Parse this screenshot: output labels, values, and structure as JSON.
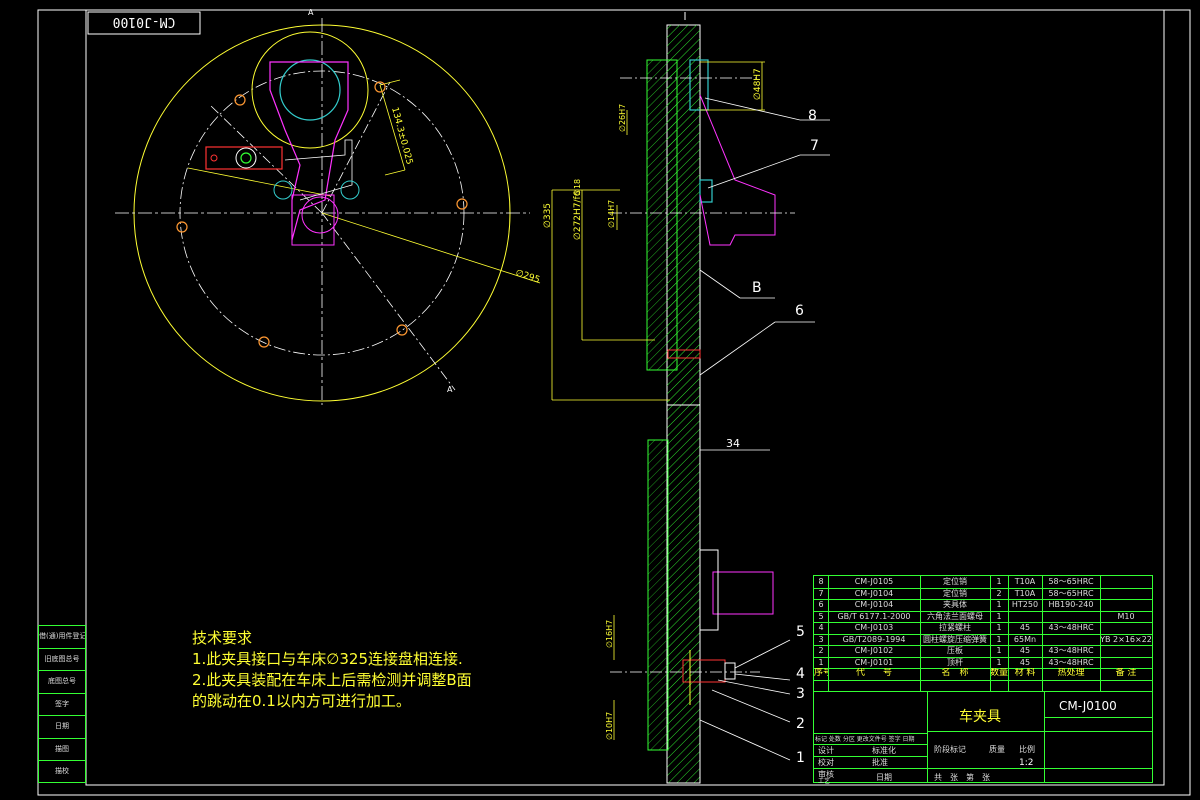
{
  "drawing_code_stamp": "CM-J0100",
  "tech_requirements": {
    "heading": "技术要求",
    "line1": "1.此夹具接口与车床∅325连接盘相连接.",
    "line2": "2.此夹具装配在车床上后需检测并调整B面",
    "line3": "的跳动在0.1以内方可进行加工。"
  },
  "dimensions": {
    "d295": "∅295",
    "d335": "∅335",
    "d272": "∅272H7/f6",
    "r134": "134.3±0.025",
    "d48": "∅48H7",
    "d26": "∅26H7",
    "d14": "∅14H7",
    "d16b": "∅16H7",
    "d10": "∅10H7",
    "d18": "∅18",
    "d17": "∅17H7",
    "len34": "34"
  },
  "callouts": {
    "c8": "8",
    "c7": "7",
    "cB": "B",
    "c6": "6",
    "c5": "5",
    "c4": "4",
    "c3": "3",
    "c2": "2",
    "c1": "1"
  },
  "bom": {
    "rows": [
      {
        "no": "8",
        "code": "CM-J0105",
        "name": "定位销",
        "qty": "1",
        "mat": "T10A",
        "heat": "58～65HRC",
        "note": ""
      },
      {
        "no": "7",
        "code": "CM-J0104",
        "name": "定位销",
        "qty": "2",
        "mat": "T10A",
        "heat": "58～65HRC",
        "note": ""
      },
      {
        "no": "6",
        "code": "CM-J0104",
        "name": "夹具体",
        "qty": "1",
        "mat": "HT250",
        "heat": "HB190-240",
        "note": ""
      },
      {
        "no": "5",
        "code": "GB/T 6177.1-2000",
        "name": "六角法兰面螺母",
        "qty": "1",
        "mat": "",
        "heat": "",
        "note": "M10"
      },
      {
        "no": "4",
        "code": "CM-J0103",
        "name": "拉紧螺柱",
        "qty": "1",
        "mat": "45",
        "heat": "43～48HRC",
        "note": ""
      },
      {
        "no": "3",
        "code": "GB/T2089-1994",
        "name": "圆柱螺旋压缩弹簧",
        "qty": "1",
        "mat": "65Mn",
        "heat": "",
        "note": "YB 2×16×22"
      },
      {
        "no": "2",
        "code": "CM-J0102",
        "name": "压板",
        "qty": "1",
        "mat": "45",
        "heat": "43～48HRC",
        "note": ""
      },
      {
        "no": "1",
        "code": "CM-J0101",
        "name": "顶杆",
        "qty": "1",
        "mat": "45",
        "heat": "43～48HRC",
        "note": ""
      }
    ],
    "header": {
      "no": "序号",
      "code": "代　　号",
      "name": "名　称",
      "qty": "数量",
      "mat": "材 料",
      "heat": "热处理",
      "note": "备 注"
    }
  },
  "title_block": {
    "title": "车夹具",
    "code": "CM-J0100",
    "scale": "1:2",
    "scale_label": "比例",
    "weight_label": "质量",
    "stage_label": "阶段标记",
    "row_labels": [
      "设计",
      "校对",
      "审核",
      "工艺"
    ],
    "std_label": "标准化",
    "approve_label": "批准",
    "date_label": "日期",
    "sheet_label": "共　张　第　张",
    "mark_cols": "标记 处数 分区 更改文件号 签字 日期"
  },
  "side_block": [
    "借(通)用件登记",
    "旧底图总号",
    "底图总号",
    "签字",
    "日期",
    "描图",
    "描校"
  ]
}
